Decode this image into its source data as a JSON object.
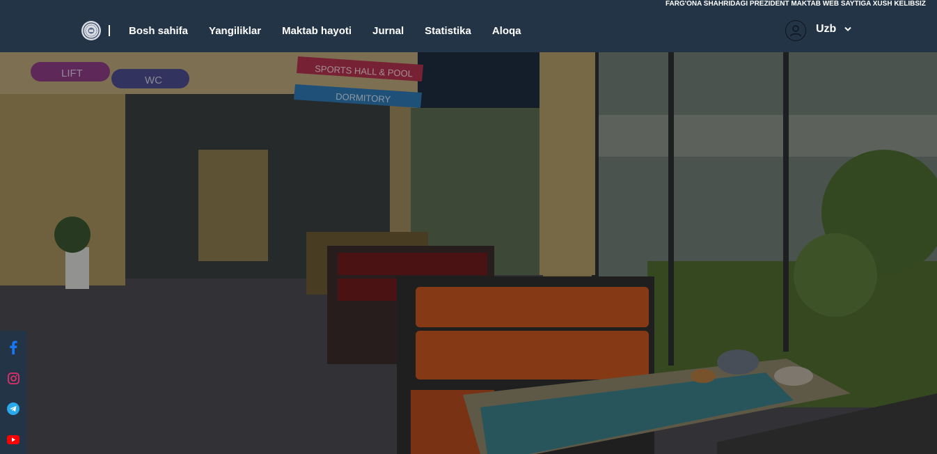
{
  "ticker": {
    "text": "FARG'ONA SHAHRIDAGI PREZIDENT MAKTAB WEB SAYTIGA XUSH KELIBSIZ"
  },
  "logo": {
    "icon": "school-emblem-icon"
  },
  "nav": {
    "items": [
      {
        "label": "Bosh sahifa"
      },
      {
        "label": "Yangiliklar"
      },
      {
        "label": "Maktab hayoti"
      },
      {
        "label": "Jurnal"
      },
      {
        "label": "Statistika"
      },
      {
        "label": "Aloqa"
      }
    ]
  },
  "user": {
    "icon": "user-circle-icon"
  },
  "language": {
    "current": "Uzb",
    "icon": "chevron-down-icon"
  },
  "hero": {
    "signs": {
      "lift": "LIFT",
      "wc": "WC",
      "sports": "SPORTS HALL & POOL",
      "dormitory": "DORMITORY"
    }
  },
  "social": [
    {
      "icon": "facebook-icon",
      "color": "#1877f2"
    },
    {
      "icon": "instagram-icon",
      "color": "#e1306c"
    },
    {
      "icon": "telegram-icon",
      "color": "#29a9eb"
    },
    {
      "icon": "youtube-icon",
      "color": "#ff0000"
    }
  ],
  "colors": {
    "header": "#243447",
    "text": "#ffffff"
  }
}
